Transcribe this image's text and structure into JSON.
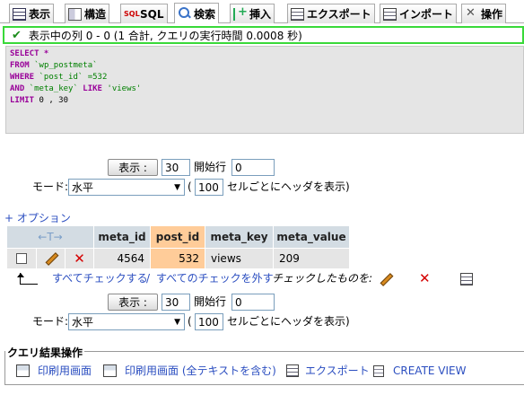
{
  "tabs": [
    {
      "label": "表示",
      "icon": "table-icon",
      "active": false
    },
    {
      "label": "構造",
      "icon": "structure-icon",
      "active": false
    },
    {
      "label": "SQL",
      "icon": "sql-icon",
      "active": false
    },
    {
      "label": "検索",
      "icon": "search-icon",
      "active": true
    },
    {
      "label": "挿入",
      "icon": "insert-icon",
      "active": false
    },
    {
      "label": "エクスポート",
      "icon": "export-icon",
      "active": false
    },
    {
      "label": "インポート",
      "icon": "import-icon",
      "active": false
    },
    {
      "label": "操作",
      "icon": "operations-icon",
      "active": false
    }
  ],
  "message": {
    "text": "表示中の列 0 - 0 (1 合計, クエリの実行時間 0.0008 秒)",
    "icon": "check-icon",
    "border_color": "#39d939"
  },
  "sql": {
    "select_kw": "SELECT",
    "select_rest": " *",
    "from_kw": "FROM",
    "from_rest": " `wp_postmeta`",
    "where_kw": "WHERE",
    "where_rest": " `post_id` =532",
    "and_kw": "AND",
    "and_mid": " `meta_key` ",
    "like_kw": "LIKE",
    "like_rest": " 'views'",
    "limit_kw": "LIMIT",
    "limit_rest": " 0 , 30"
  },
  "nav_top": {
    "show_button": "表示 :",
    "rows_value": "30",
    "start_label": "開始行",
    "start_value": "0",
    "mode_label": "モード:",
    "mode_value": "水平",
    "paren_open": "(",
    "repeat_value": "100",
    "repeat_label": "セルごとにヘッダを表示)"
  },
  "options_link": "+ オプション",
  "table": {
    "headers": [
      "meta_id",
      "post_id",
      "meta_key",
      "meta_value"
    ],
    "sorted_column": "post_id",
    "rows": [
      {
        "meta_id": "4564",
        "post_id": "532",
        "meta_key": "views",
        "meta_value": "209"
      }
    ]
  },
  "row_actions": {
    "check_all": "すべてチェックする",
    "separator": "/",
    "uncheck_all": "すべてのチェックを外す",
    "with_selected": "チェックしたものを:"
  },
  "nav_bottom": {
    "show_button": "表示 :",
    "rows_value": "30",
    "start_label": "開始行",
    "start_value": "0",
    "mode_label": "モード:",
    "mode_value": "水平",
    "paren_open": "(",
    "repeat_value": "100",
    "repeat_label": "セルごとにヘッダを表示)"
  },
  "query_ops": {
    "legend": "クエリ結果操作",
    "print_view": "印刷用画面",
    "print_view_full": "印刷用画面 (全テキストを含む)",
    "export": "エクスポート",
    "create_view": "CREATE VIEW"
  },
  "colors": {
    "header_bg": "#d3dce3",
    "sorted_bg": "#ffcc99",
    "row_bg": "#e5e5e5",
    "link": "#2b4ec0",
    "sql_keyword": "#990099"
  }
}
